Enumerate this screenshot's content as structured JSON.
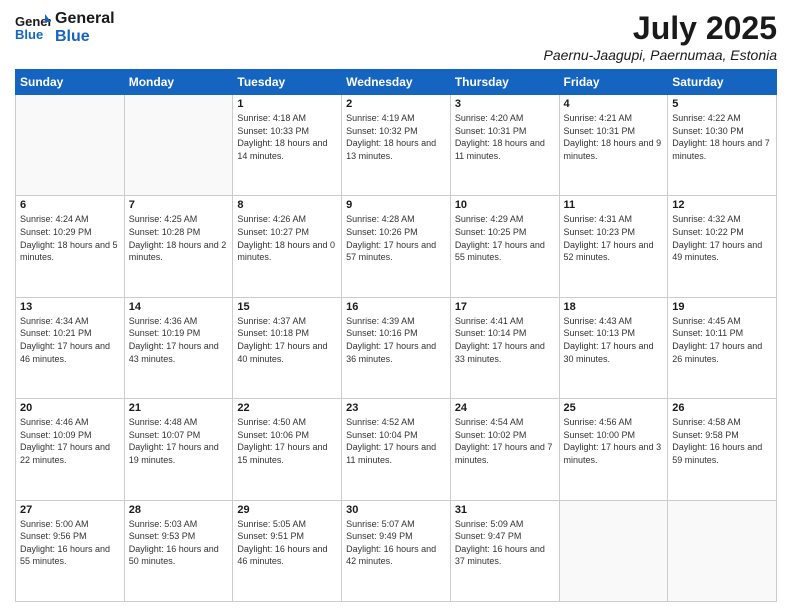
{
  "logo": {
    "line1": "General",
    "line2": "Blue"
  },
  "header": {
    "month_year": "July 2025",
    "location": "Paernu-Jaagupi, Paernumaa, Estonia"
  },
  "weekdays": [
    "Sunday",
    "Monday",
    "Tuesday",
    "Wednesday",
    "Thursday",
    "Friday",
    "Saturday"
  ],
  "weeks": [
    [
      {
        "day": "",
        "info": ""
      },
      {
        "day": "",
        "info": ""
      },
      {
        "day": "1",
        "info": "Sunrise: 4:18 AM\nSunset: 10:33 PM\nDaylight: 18 hours and 14 minutes."
      },
      {
        "day": "2",
        "info": "Sunrise: 4:19 AM\nSunset: 10:32 PM\nDaylight: 18 hours and 13 minutes."
      },
      {
        "day": "3",
        "info": "Sunrise: 4:20 AM\nSunset: 10:31 PM\nDaylight: 18 hours and 11 minutes."
      },
      {
        "day": "4",
        "info": "Sunrise: 4:21 AM\nSunset: 10:31 PM\nDaylight: 18 hours and 9 minutes."
      },
      {
        "day": "5",
        "info": "Sunrise: 4:22 AM\nSunset: 10:30 PM\nDaylight: 18 hours and 7 minutes."
      }
    ],
    [
      {
        "day": "6",
        "info": "Sunrise: 4:24 AM\nSunset: 10:29 PM\nDaylight: 18 hours and 5 minutes."
      },
      {
        "day": "7",
        "info": "Sunrise: 4:25 AM\nSunset: 10:28 PM\nDaylight: 18 hours and 2 minutes."
      },
      {
        "day": "8",
        "info": "Sunrise: 4:26 AM\nSunset: 10:27 PM\nDaylight: 18 hours and 0 minutes."
      },
      {
        "day": "9",
        "info": "Sunrise: 4:28 AM\nSunset: 10:26 PM\nDaylight: 17 hours and 57 minutes."
      },
      {
        "day": "10",
        "info": "Sunrise: 4:29 AM\nSunset: 10:25 PM\nDaylight: 17 hours and 55 minutes."
      },
      {
        "day": "11",
        "info": "Sunrise: 4:31 AM\nSunset: 10:23 PM\nDaylight: 17 hours and 52 minutes."
      },
      {
        "day": "12",
        "info": "Sunrise: 4:32 AM\nSunset: 10:22 PM\nDaylight: 17 hours and 49 minutes."
      }
    ],
    [
      {
        "day": "13",
        "info": "Sunrise: 4:34 AM\nSunset: 10:21 PM\nDaylight: 17 hours and 46 minutes."
      },
      {
        "day": "14",
        "info": "Sunrise: 4:36 AM\nSunset: 10:19 PM\nDaylight: 17 hours and 43 minutes."
      },
      {
        "day": "15",
        "info": "Sunrise: 4:37 AM\nSunset: 10:18 PM\nDaylight: 17 hours and 40 minutes."
      },
      {
        "day": "16",
        "info": "Sunrise: 4:39 AM\nSunset: 10:16 PM\nDaylight: 17 hours and 36 minutes."
      },
      {
        "day": "17",
        "info": "Sunrise: 4:41 AM\nSunset: 10:14 PM\nDaylight: 17 hours and 33 minutes."
      },
      {
        "day": "18",
        "info": "Sunrise: 4:43 AM\nSunset: 10:13 PM\nDaylight: 17 hours and 30 minutes."
      },
      {
        "day": "19",
        "info": "Sunrise: 4:45 AM\nSunset: 10:11 PM\nDaylight: 17 hours and 26 minutes."
      }
    ],
    [
      {
        "day": "20",
        "info": "Sunrise: 4:46 AM\nSunset: 10:09 PM\nDaylight: 17 hours and 22 minutes."
      },
      {
        "day": "21",
        "info": "Sunrise: 4:48 AM\nSunset: 10:07 PM\nDaylight: 17 hours and 19 minutes."
      },
      {
        "day": "22",
        "info": "Sunrise: 4:50 AM\nSunset: 10:06 PM\nDaylight: 17 hours and 15 minutes."
      },
      {
        "day": "23",
        "info": "Sunrise: 4:52 AM\nSunset: 10:04 PM\nDaylight: 17 hours and 11 minutes."
      },
      {
        "day": "24",
        "info": "Sunrise: 4:54 AM\nSunset: 10:02 PM\nDaylight: 17 hours and 7 minutes."
      },
      {
        "day": "25",
        "info": "Sunrise: 4:56 AM\nSunset: 10:00 PM\nDaylight: 17 hours and 3 minutes."
      },
      {
        "day": "26",
        "info": "Sunrise: 4:58 AM\nSunset: 9:58 PM\nDaylight: 16 hours and 59 minutes."
      }
    ],
    [
      {
        "day": "27",
        "info": "Sunrise: 5:00 AM\nSunset: 9:56 PM\nDaylight: 16 hours and 55 minutes."
      },
      {
        "day": "28",
        "info": "Sunrise: 5:03 AM\nSunset: 9:53 PM\nDaylight: 16 hours and 50 minutes."
      },
      {
        "day": "29",
        "info": "Sunrise: 5:05 AM\nSunset: 9:51 PM\nDaylight: 16 hours and 46 minutes."
      },
      {
        "day": "30",
        "info": "Sunrise: 5:07 AM\nSunset: 9:49 PM\nDaylight: 16 hours and 42 minutes."
      },
      {
        "day": "31",
        "info": "Sunrise: 5:09 AM\nSunset: 9:47 PM\nDaylight: 16 hours and 37 minutes."
      },
      {
        "day": "",
        "info": ""
      },
      {
        "day": "",
        "info": ""
      }
    ]
  ]
}
